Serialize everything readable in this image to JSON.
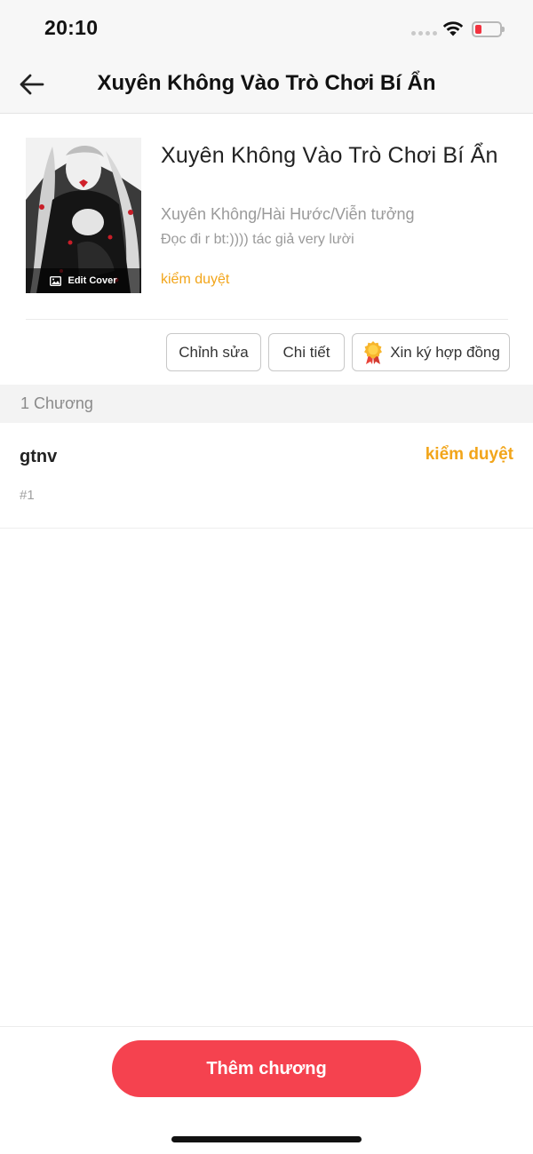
{
  "status_bar": {
    "time": "20:10",
    "battery_color": "#f2323f"
  },
  "nav": {
    "title": "Xuyên Không Vào Trò Chơi Bí Ẩn",
    "back_icon": "arrow-left-icon"
  },
  "book": {
    "title": "Xuyên Không Vào Trò Chơi Bí Ẩn",
    "genre": "Xuyên Không/Hài Hước/Viễn tưởng",
    "description": "Đọc đi r bt:)))) tác giả very lười",
    "status": "kiểm duyệt",
    "edit_cover_label": "Edit Cover"
  },
  "actions": {
    "edit_label": "Chỉnh sửa",
    "detail_label": "Chi tiết",
    "contract_label": "Xin ký hợp đồng"
  },
  "chapters": {
    "count_label": "1 Chương",
    "items": [
      {
        "title": "gtnv",
        "status": "kiểm duyệt",
        "number": "#1"
      }
    ]
  },
  "bottom": {
    "add_chapter_label": "Thêm chương"
  },
  "colors": {
    "accent": "#f5424f",
    "status_orange": "#f2a51a"
  }
}
